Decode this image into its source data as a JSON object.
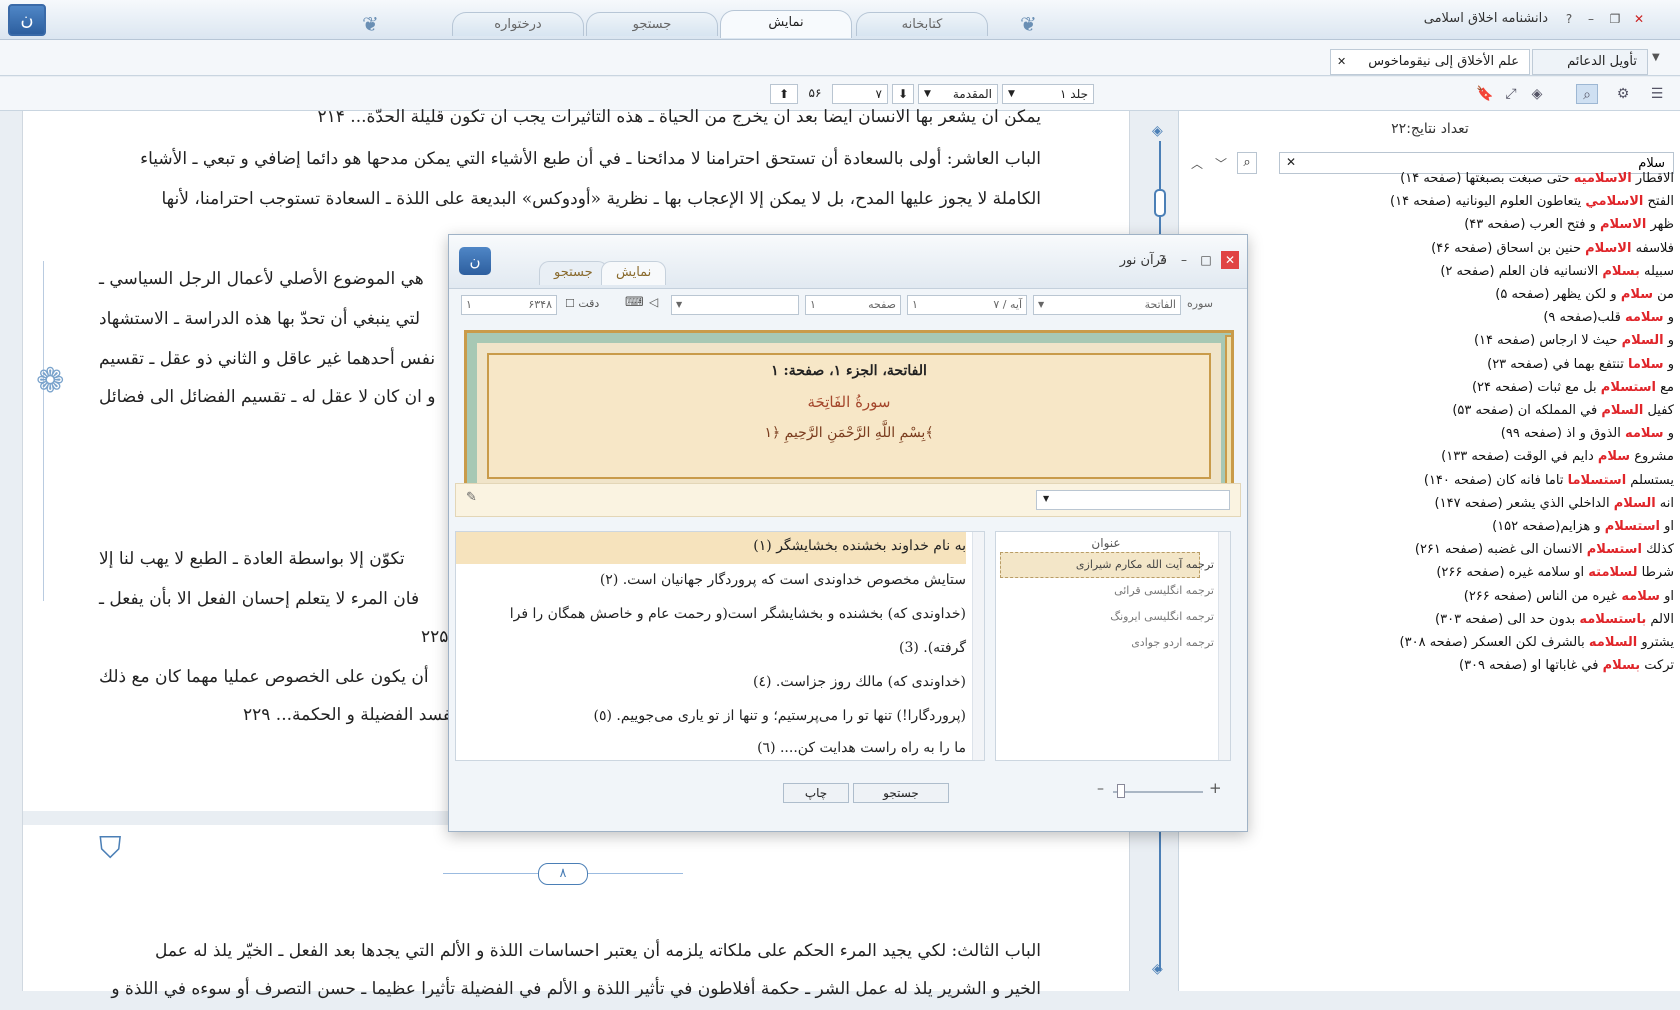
{
  "app": {
    "title": "دانشنامه اخلاق اسلامی",
    "tabs": [
      {
        "label": "كتابخانه"
      },
      {
        "label": "نمایش"
      },
      {
        "label": "جستجو"
      },
      {
        "label": "درختواره"
      }
    ]
  },
  "doc_tabs": [
    {
      "label": "علم الأخلاق إلى نيقوماخوس"
    },
    {
      "label": "تأويل الدعائم"
    }
  ],
  "toolbar": {
    "volume": "جلد ۱",
    "section": "المقدمة",
    "page": "۷",
    "total_pages": "۵۶"
  },
  "reader": {
    "lines_top": [
      "يمكن ان يشعر بها الانسان ايضا بعد ان يخرج من الحياة ـ هذه التاثيرات يجب ان تكون قليلة الحدّة... ۲۱۴",
      "الباب العاشر: أولى بالسعادة أن تستحق احترامنا لا مدائحنا ـ في أن طبع الأشياء التي يمكن مدحها هو دائما إضافي و تبعي ـ الأشياء",
      "الكاملة لا يجوز عليها المدح، بل لا يمكن إلا الإعجاب بها ـ نظرية «أودوكس» البديعة على اللذة ـ السعادة تستوجب احترامنا، لأنها"
    ],
    "lines_mid": [
      "هي الموضوع الأصلي لأعمال الرجل السياسي ـ",
      "لتي ينبغي أن تحدّ بها هذه الدراسة ـ الاستشهاد",
      "نفس أحدهما غير عاقل و الثاني ذو عقل ـ تقسيم",
      "و ان كان لا عقل له ـ تقسيم الفضائل الى فضائل"
    ],
    "lines_low": [
      "تكوّن إلا بواسطة العادة ـ الطبع لا يهب لنا إلا",
      "فان المرء لا يتعلم إحسان الفعل الا بأن يفعل ـ",
      "۲۲۵",
      "أن يكون على الخصوص عمليا مهما كان مع ذلك",
      "أو بالأقل يفسد الفضيلة و الحكمة... ۲۲۹"
    ],
    "page_number": "۸",
    "lines_bottom": [
      "الباب الثالث: لكي يجيد المرء الحكم على ملكاته يلزمه أن يعتبر احساسات اللذة و الألم التي يجدها بعد الفعل ـ الخيّر يلذ له عمل",
      "الخير و الشرير يلذ له عمل الشر ـ حكمة أفلاطون في تأثير اللذة و الألم في الفضيلة تأثيرا عظيما ـ حسن التصرف أو سوءه في اللذة و"
    ]
  },
  "results": {
    "count_label": "تعداد نتايج:۲۲",
    "search_value": "سلام",
    "items": [
      {
        "before": "الاقطار ",
        "hl": "الاسلاميه",
        "after": " حتى صبغت بصبغتها (صفحه ۱۴)"
      },
      {
        "before": "الفتح ",
        "hl": "الاسلامي",
        "after": " يتعاطون العلوم اليونانيه (صفحه ۱۴)"
      },
      {
        "before": "ظهر ",
        "hl": "الاسلام",
        "after": " و فتح العرب (صفحه ۴۳)"
      },
      {
        "before": "فلاسفه ",
        "hl": "الاسلام",
        "after": " حنين بن اسحاق (صفحه ۴۶)"
      },
      {
        "before": "سبيله ",
        "hl": "بسلام",
        "after": " الانسانيه فان العلم (صفحه ۲)"
      },
      {
        "before": "من ",
        "hl": "سلام",
        "after": " و لكن يظهر (صفحه ۵)"
      },
      {
        "before": "و ",
        "hl": "سلامه",
        "after": " قلب(صفحه ۹)"
      },
      {
        "before": "و ",
        "hl": "السلام",
        "after": " حيث لا ارجاس (صفحه ۱۴)"
      },
      {
        "before": "و ",
        "hl": "سلاما",
        "after": " تنتفع بهما في (صفحه ۲۳)"
      },
      {
        "before": "مع ",
        "hl": "استسلام",
        "after": " بل مع ثبات (صفحه ۲۴)"
      },
      {
        "before": "كفيل ",
        "hl": "السلام",
        "after": " في المملكه ان (صفحه ۵۳)"
      },
      {
        "before": "و ",
        "hl": "سلامه",
        "after": " الذوق و اذ (صفحه ۹۹)"
      },
      {
        "before": "مشروع ",
        "hl": "سلام",
        "after": " دايم في الوقت (صفحه ۱۳۳)"
      },
      {
        "before": "يستسلم ",
        "hl": "استسلاما",
        "after": " تاما فانه كان (صفحه ۱۴۰)"
      },
      {
        "before": "انه ",
        "hl": "السلام",
        "after": " الداخلي الذي يشعر (صفحه ۱۴۷)"
      },
      {
        "before": "او ",
        "hl": "استسلام",
        "after": " و هزايم(صفحه ۱۵۲)"
      },
      {
        "before": "كذلك ",
        "hl": "استسلام",
        "after": " الانسان الى غضبه (صفحه ۲۶۱)"
      },
      {
        "before": "شرطا ",
        "hl": "لسلامته",
        "after": " او سلامه غيره (صفحه ۲۶۶)"
      },
      {
        "before": "او ",
        "hl": "سلامه",
        "after": " غيره من الناس (صفحه ۲۶۶)"
      },
      {
        "before": "الالم ",
        "hl": "باستسلامه",
        "after": " بدون حد الى (صفحه ۳۰۳)"
      },
      {
        "before": "يشترو ",
        "hl": "السلامه",
        "after": " بالشرف لكن العسكر (صفحه ۳۰۸)"
      },
      {
        "before": "تركت ",
        "hl": "بسلام",
        "after": " في غاباتها او (صفحه ۳۰۹)"
      }
    ]
  },
  "quran": {
    "title": "قرآن نور",
    "tabs": [
      {
        "label": "نمایش"
      },
      {
        "label": "جستجو"
      }
    ],
    "surah_label": "سوره",
    "surah": "الفاتحة",
    "ayah_label": "آيه",
    "ayah": "۷",
    "ayah_current": "۱",
    "page_label": "صفحه",
    "page": "۱",
    "accuracy_label": "دقت",
    "total": "۶۳۴۸",
    "total_current": "۱",
    "frame_title": "الفاتحة، الجزء ۱، صفحة: ۱",
    "frame_surah": "سورةُ الفَاتِحَة",
    "frame_basmala": "بِسْمِ اللَّهِ الرَّحْمَنِ الرَّحِيمِ ﴿۱﴾",
    "translation_lines": [
      "به نام خداوند بخشنده بخشايشگر (١)",
      "ستايش مخصوص خداوندى است كه پروردگار جهانيان است. (٢)",
      "(خداوندى كه) بخشنده و بخشايشگر است(و رحمت عام و خاصش همگان را فرا",
      "گرفته). (3)",
      "(خداوندى كه) مالك روز جزاست. (٤)",
      "(پروردگارا!) تنها تو را مى‌پرستيم؛ و تنها از تو يارى مى‌جوييم. (٥)",
      "ما را به راه راست هدايت كن.... (٦)"
    ],
    "translations_header": "عنوان",
    "translations": [
      "ترجمه آيت الله مكارم شيرازى",
      "ترجمه انگليسى قرائى",
      "ترجمه انگليسى ايرونگ",
      "ترجمه اردو جوادى"
    ],
    "print_label": "چاپ",
    "search_label": "جستجو"
  }
}
